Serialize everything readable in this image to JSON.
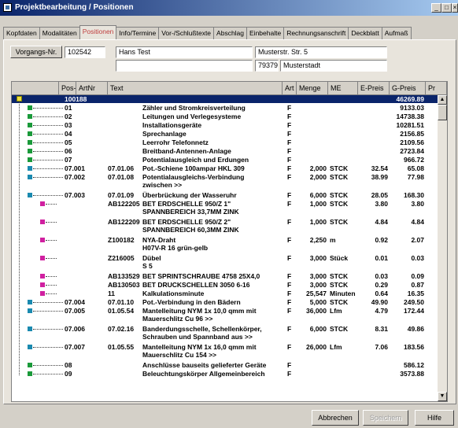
{
  "window": {
    "title": "Projektbearbeitung / Positionen",
    "controls": {
      "minimize": "_",
      "maximize": "□",
      "close": "×"
    }
  },
  "tabs": [
    {
      "label": "Kopfdaten",
      "active": false
    },
    {
      "label": "Modalitäten",
      "active": false
    },
    {
      "label": "Positionen",
      "active": true
    },
    {
      "label": "Info/Termine",
      "active": false
    },
    {
      "label": "Vor-/Schlußtexte",
      "active": false
    },
    {
      "label": "Abschlag",
      "active": false
    },
    {
      "label": "Einbehalte",
      "active": false
    },
    {
      "label": "Rechnungsanschrift",
      "active": false
    },
    {
      "label": "Deckblatt",
      "active": false
    },
    {
      "label": "Aufmaß",
      "active": false
    }
  ],
  "header": {
    "vorgang_button": "Vorgangs-Nr.",
    "vorgang_nr": "102542",
    "name": "Hans Test",
    "name2": "",
    "street": "Musterstr. Str. 5",
    "street2": "",
    "zip": "79379",
    "city": "Musterstadt"
  },
  "columns": [
    "Pos-Nr.",
    "ArtNr",
    "Text",
    "Art",
    "Menge",
    "ME",
    "E-Preis",
    "G-Preis",
    "Pr"
  ],
  "rows": [
    {
      "pos": "100188",
      "art_nr": "",
      "text": "",
      "text2": "",
      "art": "",
      "menge": "",
      "me": "",
      "epreis": "",
      "gpreis": "46269.89",
      "node": "yellow",
      "selected": true
    },
    {
      "pos": "01",
      "art_nr": "",
      "text": "Zähler und Stromkreisverteilung",
      "text2": "",
      "art": "F",
      "menge": "",
      "me": "",
      "epreis": "",
      "gpreis": "9133.03",
      "node": "green"
    },
    {
      "pos": "02",
      "art_nr": "",
      "text": "Leitungen und Verlegesysteme",
      "text2": "",
      "art": "F",
      "menge": "",
      "me": "",
      "epreis": "",
      "gpreis": "14738.38",
      "node": "green"
    },
    {
      "pos": "03",
      "art_nr": "",
      "text": "Installationsgeräte",
      "text2": "",
      "art": "F",
      "menge": "",
      "me": "",
      "epreis": "",
      "gpreis": "10281.51",
      "node": "green"
    },
    {
      "pos": "04",
      "art_nr": "",
      "text": "Sprechanlage",
      "text2": "",
      "art": "F",
      "menge": "",
      "me": "",
      "epreis": "",
      "gpreis": "2156.85",
      "node": "green"
    },
    {
      "pos": "05",
      "art_nr": "",
      "text": "Leerrohr Telefonnetz",
      "text2": "",
      "art": "F",
      "menge": "",
      "me": "",
      "epreis": "",
      "gpreis": "2109.56",
      "node": "green"
    },
    {
      "pos": "06",
      "art_nr": "",
      "text": "Breitband-Antennen-Anlage",
      "text2": "",
      "art": "F",
      "menge": "",
      "me": "",
      "epreis": "",
      "gpreis": "2723.84",
      "node": "green"
    },
    {
      "pos": "07",
      "art_nr": "",
      "text": "Potentialausgleich und Erdungen",
      "text2": "",
      "art": "F",
      "menge": "",
      "me": "",
      "epreis": "",
      "gpreis": "966.72",
      "node": "green"
    },
    {
      "pos": "07.001",
      "art_nr": "07.01.06",
      "text": "Pot.-Schiene 100ampar HKL 309",
      "text2": "",
      "art": "F",
      "menge": "2,000",
      "me": "STCK",
      "epreis": "32.54",
      "gpreis": "65.08",
      "node": "blue"
    },
    {
      "pos": "07.002",
      "art_nr": "07.01.08",
      "text": "Potentialausgleichs-Verbindung",
      "text2": "zwischen >>",
      "art": "F",
      "menge": "2,000",
      "me": "STCK",
      "epreis": "38.99",
      "gpreis": "77.98",
      "node": "blue"
    },
    {
      "pos": "07.003",
      "art_nr": "07.01.09",
      "text": "Überbrückung der Wasseruhr",
      "text2": "",
      "art": "F",
      "menge": "6,000",
      "me": "STCK",
      "epreis": "28.05",
      "gpreis": "168.30",
      "node": "blue"
    },
    {
      "pos": "",
      "art_nr": "AB122205",
      "text": "BET ERDSCHELLE 950/Z 1\"",
      "text2": "SPANNBEREICH 33,7MM ZINK",
      "art": "F",
      "menge": "1,000",
      "me": "STCK",
      "epreis": "3.80",
      "gpreis": "3.80",
      "node": "pink"
    },
    {
      "pos": "",
      "art_nr": "AB122209",
      "text": "BET ERDSCHELLE 950/Z 2\"",
      "text2": "SPANNBEREICH 60,3MM ZINK",
      "art": "F",
      "menge": "1,000",
      "me": "STCK",
      "epreis": "4.84",
      "gpreis": "4.84",
      "node": "pink"
    },
    {
      "pos": "",
      "art_nr": "Z100182",
      "text": "NYA-Draht",
      "text2": "H07V-R  16 grün-gelb",
      "art": "F",
      "menge": "2,250",
      "me": "m",
      "epreis": "0.92",
      "gpreis": "2.07",
      "node": "pink"
    },
    {
      "pos": "",
      "art_nr": "Z216005",
      "text": "Dübel",
      "text2": "S  5",
      "art": "F",
      "menge": "3,000",
      "me": "Stück",
      "epreis": "0.01",
      "gpreis": "0.03",
      "node": "pink"
    },
    {
      "pos": "",
      "art_nr": "AB133529",
      "text": "BET SPRINTSCHRAUBE 4758 25X4,0",
      "text2": "",
      "art": "F",
      "menge": "3,000",
      "me": "STCK",
      "epreis": "0.03",
      "gpreis": "0.09",
      "node": "pink"
    },
    {
      "pos": "",
      "art_nr": "AB130503",
      "text": "BET DRUCKSCHELLEN 3050 6-16",
      "text2": "",
      "art": "F",
      "menge": "3,000",
      "me": "STCK",
      "epreis": "0.29",
      "gpreis": "0.87",
      "node": "pink"
    },
    {
      "pos": "",
      "art_nr": "11",
      "text": "Kalkulationsminute",
      "text2": "",
      "art": "F",
      "menge": "25,547",
      "me": "Minuten",
      "epreis": "0.64",
      "gpreis": "16.35",
      "node": "pink"
    },
    {
      "pos": "07.004",
      "art_nr": "07.01.10",
      "text": "Pot.-Verbindung in den Bädern",
      "text2": "",
      "art": "F",
      "menge": "5,000",
      "me": "STCK",
      "epreis": "49.90",
      "gpreis": "249.50",
      "node": "blue"
    },
    {
      "pos": "07.005",
      "art_nr": "01.05.54",
      "text": "Mantelleitung NYM  1x 10,0 qmm mit",
      "text2": "Mauerschlitz Cu  96 >>",
      "art": "F",
      "menge": "36,000",
      "me": "Lfm",
      "epreis": "4.79",
      "gpreis": "172.44",
      "node": "blue"
    },
    {
      "pos": "07.006",
      "art_nr": "07.02.16",
      "text": "Banderdungsschelle, Schellenkörper,",
      "text2": "Schrauben und Spannband aus  >>",
      "art": "F",
      "menge": "6,000",
      "me": "STCK",
      "epreis": "8.31",
      "gpreis": "49.86",
      "node": "blue"
    },
    {
      "pos": "07.007",
      "art_nr": "01.05.55",
      "text": "Mantelleitung NYM  1x 16,0 qmm mit",
      "text2": "Mauerschlitz Cu 154 >>",
      "art": "F",
      "menge": "26,000",
      "me": "Lfm",
      "epreis": "7.06",
      "gpreis": "183.56",
      "node": "blue"
    },
    {
      "pos": "08",
      "art_nr": "",
      "text": "Anschlüsse bauseits gelieferter Geräte",
      "text2": "",
      "art": "F",
      "menge": "",
      "me": "",
      "epreis": "",
      "gpreis": "586.12",
      "node": "green"
    },
    {
      "pos": "09",
      "art_nr": "",
      "text": "Beleuchtungskörper Allgemeinbereich",
      "text2": "",
      "art": "F",
      "menge": "",
      "me": "",
      "epreis": "",
      "gpreis": "3573.88",
      "node": "green"
    }
  ],
  "buttons": {
    "abbrechen": "Abbrechen",
    "speichern": "Speichern",
    "hilfe": "Hilfe"
  }
}
